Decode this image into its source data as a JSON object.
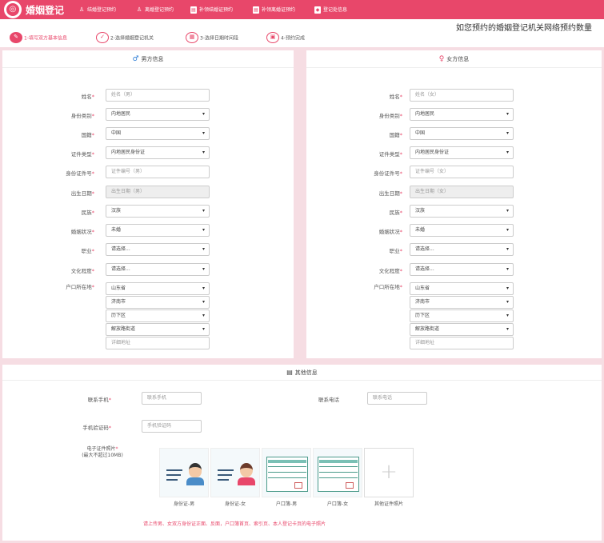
{
  "nav": {
    "brand": "婚姻登记",
    "items": [
      "结婚登记预约",
      "离婚登记预约",
      "补领结婚证预约",
      "补领离婚证预约",
      "登记处信息"
    ]
  },
  "marquee": "如您预约的婚姻登记机关网络预约数量",
  "steps": [
    "1-填写双方基本信息",
    "2-选择婚姻登记机关",
    "3-选择日期时间段",
    "4-预约完成"
  ],
  "male": {
    "title": "男方信息",
    "labels": [
      "姓名",
      "身份类别",
      "国籍",
      "证件类型",
      "身份证件号",
      "出生日期",
      "民族",
      "婚姻状况",
      "职业",
      "文化程度",
      "户口所在地"
    ],
    "name_ph": "姓名（男）",
    "id_type": "内地居民",
    "nation": "中国",
    "cert_type": "内地居民身份证",
    "id_ph": "证件编号（男）",
    "birth_ph": "出生日期（男）",
    "ethnic": "汉族",
    "marital": "未婚",
    "job": "请选择...",
    "edu": "请选择...",
    "province": "山东省",
    "city": "济南市",
    "district": "历下区",
    "street": "解放路街道",
    "addr_ph": "详细地址"
  },
  "female": {
    "title": "女方信息",
    "labels": [
      "姓名",
      "身份类别",
      "国籍",
      "证件类型",
      "身份证件号",
      "出生日期",
      "民族",
      "婚姻状况",
      "职业",
      "文化程度",
      "户口所在地"
    ],
    "name_ph": "姓名（女）",
    "id_type": "内地居民",
    "nation": "中国",
    "cert_type": "内地居民身份证",
    "id_ph": "证件编号（女）",
    "birth_ph": "出生日期（女）",
    "ethnic": "汉族",
    "marital": "未婚",
    "job": "请选择...",
    "edu": "请选择...",
    "province": "山东省",
    "city": "济南市",
    "district": "历下区",
    "street": "解放路街道",
    "addr_ph": "详细地址"
  },
  "other": {
    "title": "其他信息",
    "phone_label": "联系手机",
    "phone_ph": "联系手机",
    "tel_label": "联系电话",
    "tel_ph": "联系电话",
    "code_label": "手机验证码",
    "code_ph": "手机验证码",
    "photo_label_1": "电子证件照片",
    "photo_label_2": "(最大不超过10MB)",
    "photos": [
      "身份证-男",
      "身份证-女",
      "户口簿-男",
      "户口簿-女",
      "其他证件照片"
    ],
    "note": "请上传男、女双方身份证正面、反面，户口簿首页、索引页、本人登记卡页的电子照片"
  },
  "colors": {
    "accent": "#e8476a",
    "page_bg": "#f6dde3"
  },
  "icons": {
    "logo": "rings-logo",
    "male": "male-symbol-icon",
    "female": "female-symbol-icon",
    "other": "document-icon",
    "add": "plus-icon"
  }
}
